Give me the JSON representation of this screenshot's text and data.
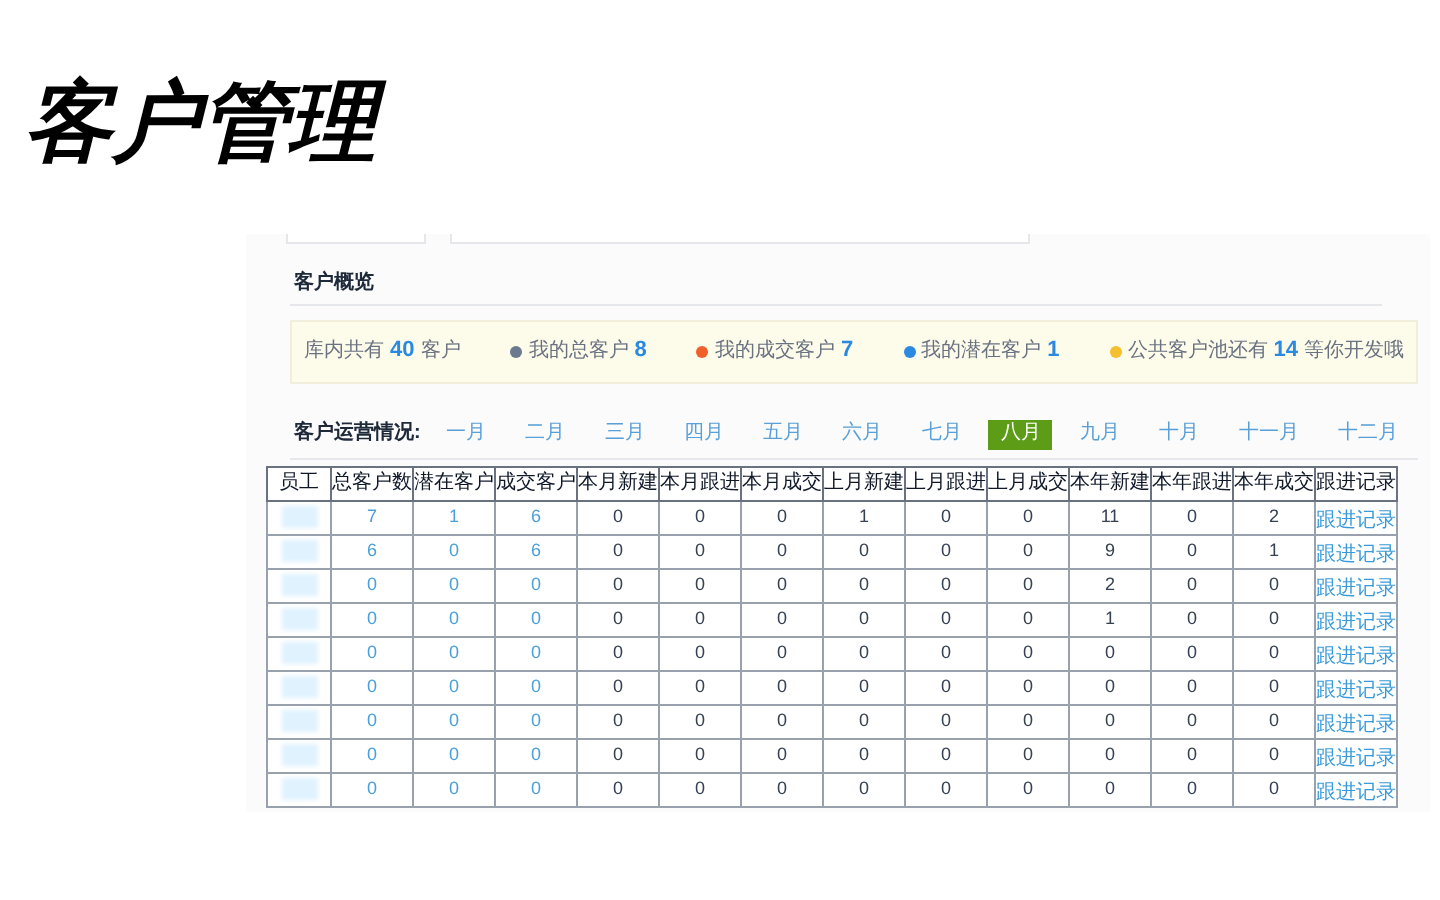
{
  "page_title": "客户管理",
  "overview": {
    "title": "客户概览",
    "stats": [
      {
        "label": "库内共有",
        "value": "40",
        "suffix": "客户"
      },
      {
        "label": "我的总客户",
        "value": "8",
        "color": "#6b7a8f"
      },
      {
        "label": "我的成交客户",
        "value": "7",
        "color": "#f0602a"
      },
      {
        "label": "我的潜在客户",
        "value": "1",
        "color": "#2a8ae0"
      },
      {
        "label": "公共客户池还有",
        "value": "14",
        "suffix": "等你开发哦",
        "color": "#f5c030"
      }
    ]
  },
  "operations": {
    "title": "客户运营情况:",
    "months": [
      {
        "label": "一月",
        "selected": false
      },
      {
        "label": "二月",
        "selected": false
      },
      {
        "label": "三月",
        "selected": false
      },
      {
        "label": "四月",
        "selected": false
      },
      {
        "label": "五月",
        "selected": false
      },
      {
        "label": "六月",
        "selected": false
      },
      {
        "label": "七月",
        "selected": false
      },
      {
        "label": "八月",
        "selected": true
      },
      {
        "label": "九月",
        "selected": false
      },
      {
        "label": "十月",
        "selected": false
      },
      {
        "label": "十一月",
        "selected": false
      },
      {
        "label": "十二月",
        "selected": false
      }
    ]
  },
  "table": {
    "columns": [
      {
        "label": "员工",
        "kind": "name"
      },
      {
        "label": "总客户数",
        "kind": "count"
      },
      {
        "label": "潜在客户",
        "kind": "count"
      },
      {
        "label": "成交客户",
        "kind": "count"
      },
      {
        "label": "本月新建",
        "kind": "stat"
      },
      {
        "label": "本月跟进",
        "kind": "stat"
      },
      {
        "label": "本月成交",
        "kind": "stat"
      },
      {
        "label": "上月新建",
        "kind": "stat"
      },
      {
        "label": "上月跟进",
        "kind": "stat"
      },
      {
        "label": "上月成交",
        "kind": "stat"
      },
      {
        "label": "本年新建",
        "kind": "stat"
      },
      {
        "label": "本年跟进",
        "kind": "stat"
      },
      {
        "label": "本年成交",
        "kind": "stat"
      },
      {
        "label": "跟进记录",
        "kind": "link"
      }
    ],
    "rows": [
      [
        "",
        "7",
        "1",
        "6",
        "0",
        "0",
        "0",
        "1",
        "0",
        "0",
        "11",
        "0",
        "2",
        "跟进记录"
      ],
      [
        "",
        "6",
        "0",
        "6",
        "0",
        "0",
        "0",
        "0",
        "0",
        "0",
        "9",
        "0",
        "1",
        "跟进记录"
      ],
      [
        "",
        "0",
        "0",
        "0",
        "0",
        "0",
        "0",
        "0",
        "0",
        "0",
        "2",
        "0",
        "0",
        "跟进记录"
      ],
      [
        "",
        "0",
        "0",
        "0",
        "0",
        "0",
        "0",
        "0",
        "0",
        "0",
        "1",
        "0",
        "0",
        "跟进记录"
      ],
      [
        "",
        "0",
        "0",
        "0",
        "0",
        "0",
        "0",
        "0",
        "0",
        "0",
        "0",
        "0",
        "0",
        "跟进记录"
      ],
      [
        "",
        "0",
        "0",
        "0",
        "0",
        "0",
        "0",
        "0",
        "0",
        "0",
        "0",
        "0",
        "0",
        "跟进记录"
      ],
      [
        "",
        "0",
        "0",
        "0",
        "0",
        "0",
        "0",
        "0",
        "0",
        "0",
        "0",
        "0",
        "0",
        "跟进记录"
      ],
      [
        "",
        "0",
        "0",
        "0",
        "0",
        "0",
        "0",
        "0",
        "0",
        "0",
        "0",
        "0",
        "0",
        "跟进记录"
      ],
      [
        "",
        "0",
        "0",
        "0",
        "0",
        "0",
        "0",
        "0",
        "0",
        "0",
        "0",
        "0",
        "0",
        "跟进记录"
      ]
    ]
  }
}
